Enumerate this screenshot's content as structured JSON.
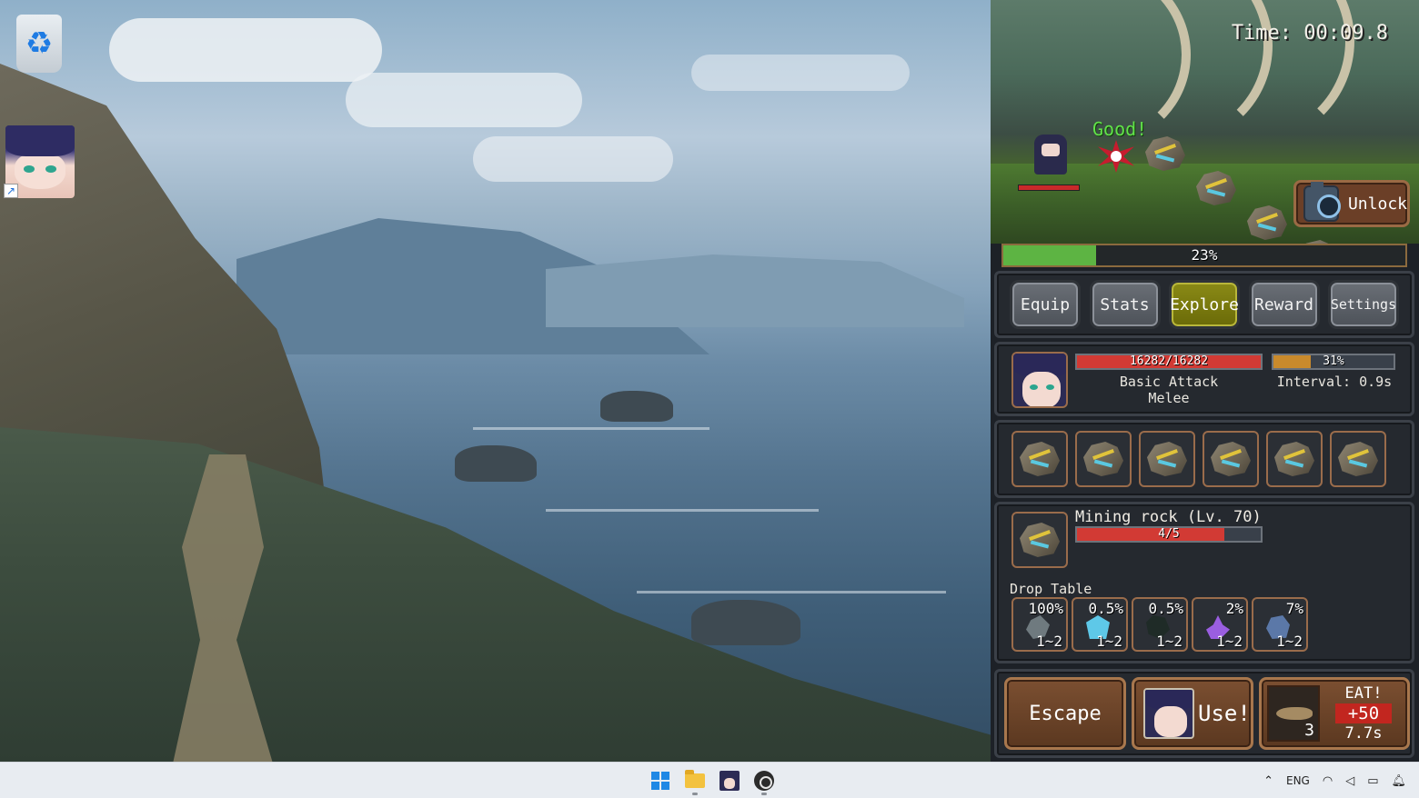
{
  "desktop": {
    "icons": [
      {
        "name": "Recycle Bin",
        "icon": "recycle-bin-icon"
      },
      {
        "name": "Game shortcut",
        "icon": "character-portrait-icon"
      }
    ]
  },
  "game": {
    "timer": "Time: 00:09.8",
    "hit_text": "Good!",
    "unlock_label": "Unlock",
    "progress": {
      "value": 0.23,
      "label": "23%"
    },
    "nav": [
      {
        "label": "Equip",
        "active": false
      },
      {
        "label": "Stats",
        "active": false
      },
      {
        "label": "Explore",
        "active": true
      },
      {
        "label": "Reward",
        "active": false
      },
      {
        "label": "Settings",
        "active": false
      }
    ],
    "player": {
      "hp_text": "16282/16282",
      "hp_fraction": 1.0,
      "attack_name": "Basic Attack",
      "attack_type": "Melee",
      "charge_text": "31%",
      "charge_fraction": 0.31,
      "interval": "Interval: 0.9s"
    },
    "queue_count": 6,
    "target": {
      "name": "Mining rock (Lv. 70)",
      "hp_text": "4/5",
      "hp_fraction": 0.8
    },
    "drop_table": {
      "label": "Drop Table",
      "items": [
        {
          "chance": "100%",
          "qty": "1~2",
          "icon": "stone-ore-icon",
          "color": "#6f7a7f"
        },
        {
          "chance": "0.5%",
          "qty": "1~2",
          "icon": "blue-crystal-icon",
          "color": "#5ec8e8"
        },
        {
          "chance": "0.5%",
          "qty": "1~2",
          "icon": "dark-ore-icon",
          "color": "#1f2b27"
        },
        {
          "chance": "2%",
          "qty": "1~2",
          "icon": "purple-crystal-icon",
          "color": "#9a5ee0"
        },
        {
          "chance": "7%",
          "qty": "1~2",
          "icon": "blue-ore-icon",
          "color": "#5b78a8"
        }
      ]
    },
    "actions": {
      "escape": "Escape",
      "use": "Use!",
      "eat_title": "EAT!",
      "eat_amount": "+50",
      "eat_time": "7.7s",
      "food_count": "3"
    },
    "colors": {
      "hp_red": "#d23a34",
      "charge_orange": "#c98a2c",
      "progress_green": "#5db443",
      "explore_active": "#7a7a10"
    }
  },
  "taskbar": {
    "apps": [
      "windows-start-icon",
      "file-explorer-icon",
      "game-app-icon",
      "obs-icon"
    ],
    "language": "ENG"
  }
}
